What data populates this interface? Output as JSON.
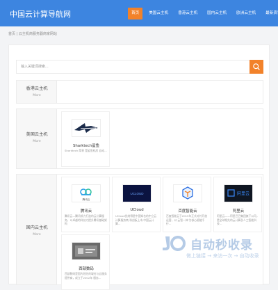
{
  "header": {
    "logo": "中国云计算导航网",
    "nav": [
      {
        "label": "首页",
        "active": true
      },
      {
        "label": "美国云主机",
        "active": false
      },
      {
        "label": "香港云主机",
        "active": false
      },
      {
        "label": "国内云主机",
        "active": false
      },
      {
        "label": "欧洲云主机",
        "active": false
      },
      {
        "label": "最新资讯",
        "active": false
      }
    ],
    "colors": {
      "bar": "#3d85e0",
      "active": "#f2822a"
    }
  },
  "breadcrumb": {
    "home": "首页",
    "sep": " | ",
    "current": "云主机商服务器商家网站"
  },
  "search": {
    "placeholder": "输入关键词搜索...",
    "value": "",
    "icon": "search-icon"
  },
  "categories": [
    {
      "title": "香港云主机",
      "more": "More"
    },
    {
      "title": "美国云主机",
      "more": "More"
    },
    {
      "title": "国内云主机",
      "more": "More"
    }
  ],
  "cards": {
    "sharktech": {
      "name": "Sharktech鲨鱼",
      "desc": "Sharktech 简称 是鲨鱼机房 自动更...",
      "logo_text": "SHARKTECH",
      "icon": "shark-logo-icon"
    },
    "tengxun": {
      "name": "腾讯云",
      "desc": "腾讯云—腾讯倾力打造的云计算服务，以卓越的科技力提升腾讯基础架构",
      "logo_text": "腾讯云",
      "icon": "tencent-cloud-logo-icon"
    },
    "ucloud": {
      "name": "UCloud",
      "desc": "UCloud优刻得是中国知名的中立云计算服务商,科创板上市,中国云计算...",
      "logo_text": "UCLOUD",
      "icon": "ucloud-logo-icon"
    },
    "baidu": {
      "name": "百度智能云",
      "desc": "百度智能云于2015年正式对外开放运营，以‘云智一体’为核心赋能千行...",
      "logo_text": "",
      "icon": "baidu-cloud-logo-icon"
    },
    "aliyun": {
      "name": "阿里云",
      "desc": "阿里云——阿里巴巴集团旗下公司，是全球领先的云计算及人工智能科技...",
      "logo_text": "阿里云",
      "icon": "aliyun-logo-icon"
    },
    "xibu": {
      "name": "西部数码",
      "desc": "西部数码是国内领先的域名与云服务提供商，成立于2002年 服务...",
      "logo_text": "",
      "icon": "west-digital-logo-icon"
    }
  },
  "watermark": {
    "title": "自动秒收录",
    "subtitle": "做上链接 → 来访一次 → 自动收录"
  }
}
